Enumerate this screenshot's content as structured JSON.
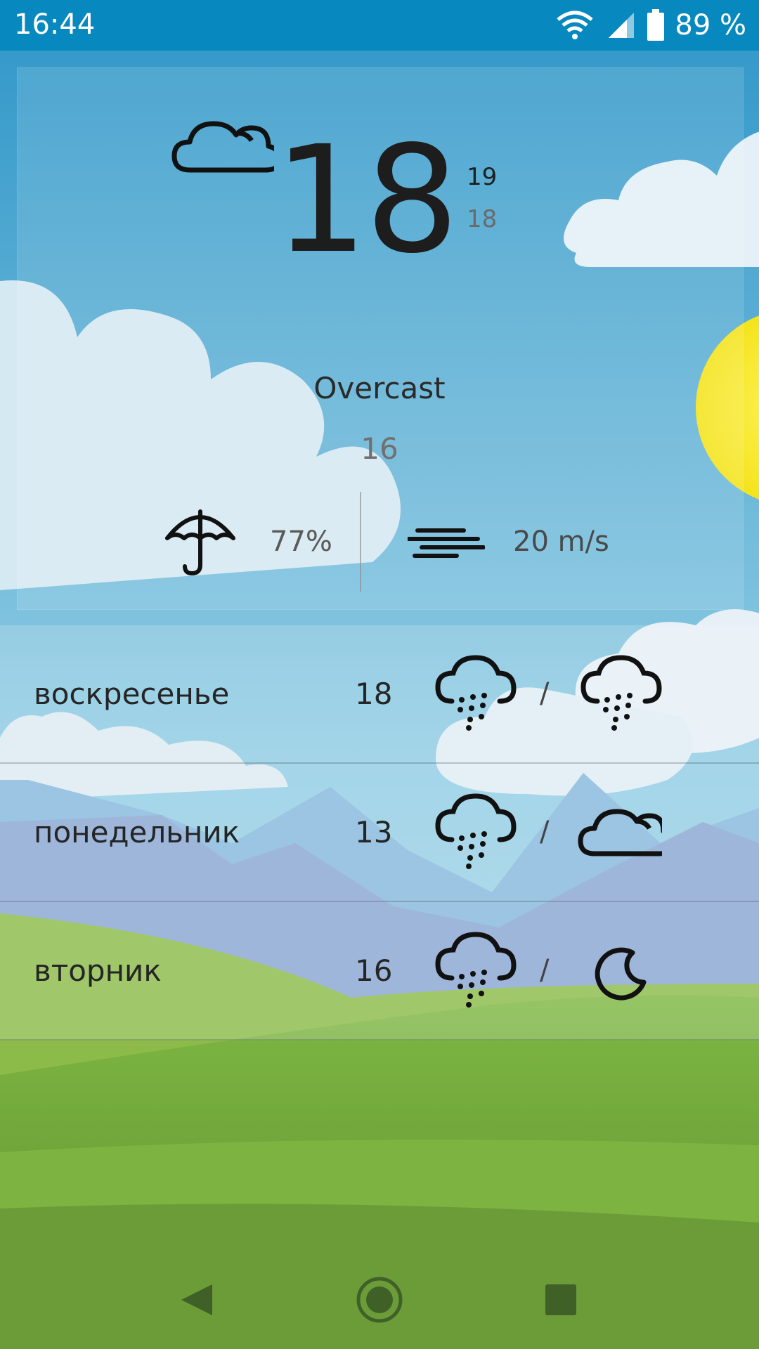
{
  "status_bar": {
    "time": "16:44",
    "battery": "89 %",
    "icons": [
      "wifi-icon",
      "signal-icon",
      "battery-icon"
    ]
  },
  "current": {
    "condition_icon": "cloud-icon",
    "temperature": "18",
    "high": "19",
    "low": "18",
    "condition": "Overcast",
    "feels_like": "16",
    "precipitation": "77%",
    "wind": "20 m/s"
  },
  "forecast": [
    {
      "day": "воскресенье",
      "temp": "18",
      "day_icon": "rain-icon",
      "night_icon": "rain-icon"
    },
    {
      "day": "понедельник",
      "temp": "13",
      "day_icon": "rain-icon",
      "night_icon": "cloud-icon"
    },
    {
      "day": "вторник",
      "temp": "16",
      "day_icon": "rain-icon",
      "night_icon": "moon-icon"
    }
  ],
  "separator": "/",
  "nav": {
    "icons": [
      "back-icon",
      "home-icon",
      "recents-icon"
    ]
  }
}
